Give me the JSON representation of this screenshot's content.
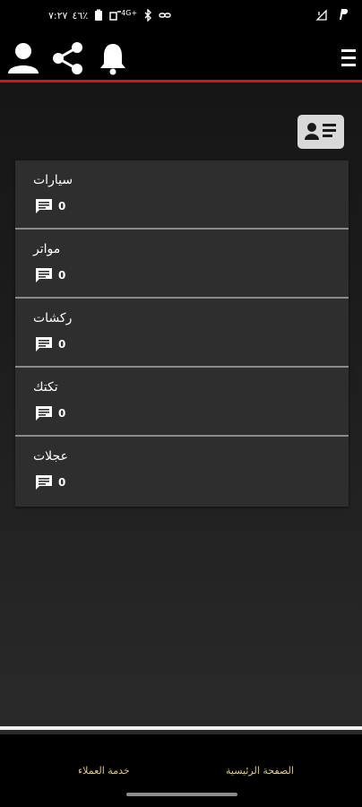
{
  "status_bar": {
    "time": "٧:٢٧",
    "battery": "٤٦٪",
    "network": "4G+",
    "icons": [
      "battery-icon",
      "wifi-calling-icon",
      "signal-icon",
      "bluetooth-icon",
      "link-icon",
      "no-signal-icon",
      "paypal-icon"
    ]
  },
  "app_bar": {
    "icons": [
      "user-icon",
      "share-icon",
      "bell-icon",
      "menu-icon"
    ],
    "accent_color": "#d01818"
  },
  "profile_button": {
    "icon": "contact-card-icon"
  },
  "categories": [
    {
      "title": "سيارات",
      "count": "0",
      "icon": "comment-icon"
    },
    {
      "title": "موا‌تر",
      "count": "0",
      "icon": "comment-icon"
    },
    {
      "title": "ركشات",
      "count": "0",
      "icon": "comment-icon"
    },
    {
      "title": "تكتك",
      "count": "0",
      "icon": "comment-icon"
    },
    {
      "title": "عجلات",
      "count": "0",
      "icon": "comment-icon"
    }
  ],
  "bottom_nav": {
    "home_label": "الصفحة الرئيسية",
    "support_label": "خدمة العملاء"
  }
}
